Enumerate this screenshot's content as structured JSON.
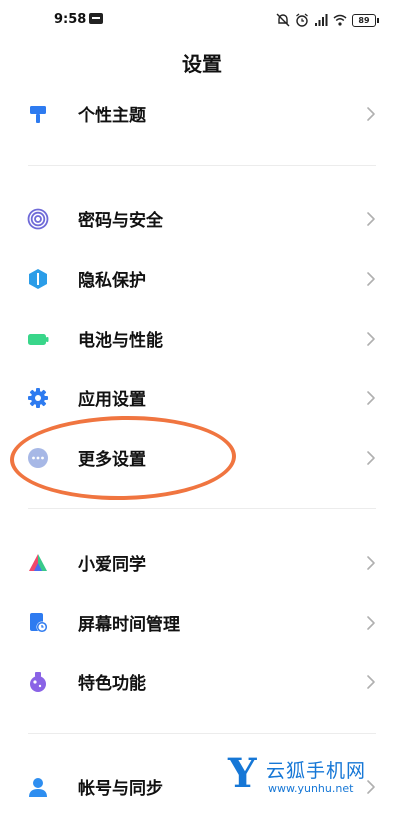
{
  "status_bar": {
    "time": "9:58",
    "battery": "89"
  },
  "page": {
    "title": "设置"
  },
  "items": [
    {
      "label": "个性主题",
      "icon": "paint-roller-icon",
      "color": "#2e7bf0"
    },
    {
      "label": "密码与安全",
      "icon": "fingerprint-icon",
      "color": "#6f6ad8"
    },
    {
      "label": "隐私保护",
      "icon": "privacy-shield-icon",
      "color": "#2b9de8"
    },
    {
      "label": "电池与性能",
      "icon": "battery-icon",
      "color": "#39d68a"
    },
    {
      "label": "应用设置",
      "icon": "gear-icon",
      "color": "#2e7bf0"
    },
    {
      "label": "更多设置",
      "icon": "more-dots-icon",
      "color": "#a7b8e6"
    },
    {
      "label": "小爱同学",
      "icon": "xiaoai-icon",
      "color": "#4a6cf0"
    },
    {
      "label": "屏幕时间管理",
      "icon": "hourglass-clock-icon",
      "color": "#2e7bf0"
    },
    {
      "label": "特色功能",
      "icon": "potion-icon",
      "color": "#8a63e6"
    },
    {
      "label": "帐号与同步",
      "icon": "user-icon",
      "color": "#2e8ef0"
    }
  ],
  "watermark": {
    "letter": "Y",
    "name": "云狐手机网",
    "url": "www.yunhu.net"
  }
}
